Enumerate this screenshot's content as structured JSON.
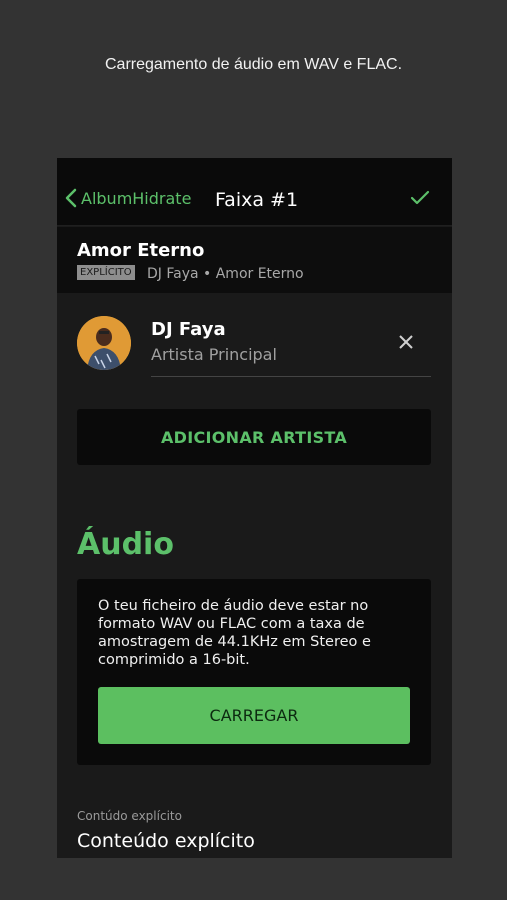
{
  "caption": "Carregamento de áudio em WAV e FLAC.",
  "topbar": {
    "back_label": "AlbumHidrate",
    "title": "Faixa #1",
    "confirm_icon": "check-icon"
  },
  "track": {
    "title": "Amor Eterno",
    "badge": "EXPLÍCITO",
    "subtitle": "DJ Faya • Amor Eterno"
  },
  "artist": {
    "name": "DJ Faya",
    "role": "Artista Principal"
  },
  "add_artist_label": "ADICIONAR ARTISTA",
  "audio": {
    "section_title": "Áudio",
    "description": "O teu ficheiro de áudio deve estar no formato WAV ou FLAC com a taxa de amostragem de 44.1KHz em Stereo e comprimido a 16-bit.",
    "upload_label": "CARREGAR"
  },
  "explicit_field": {
    "label": "Contúdo explícito",
    "value": "Conteúdo explícito"
  },
  "colors": {
    "accent": "#5cc06a",
    "background": "#333333",
    "panel": "#1a1a1a"
  }
}
